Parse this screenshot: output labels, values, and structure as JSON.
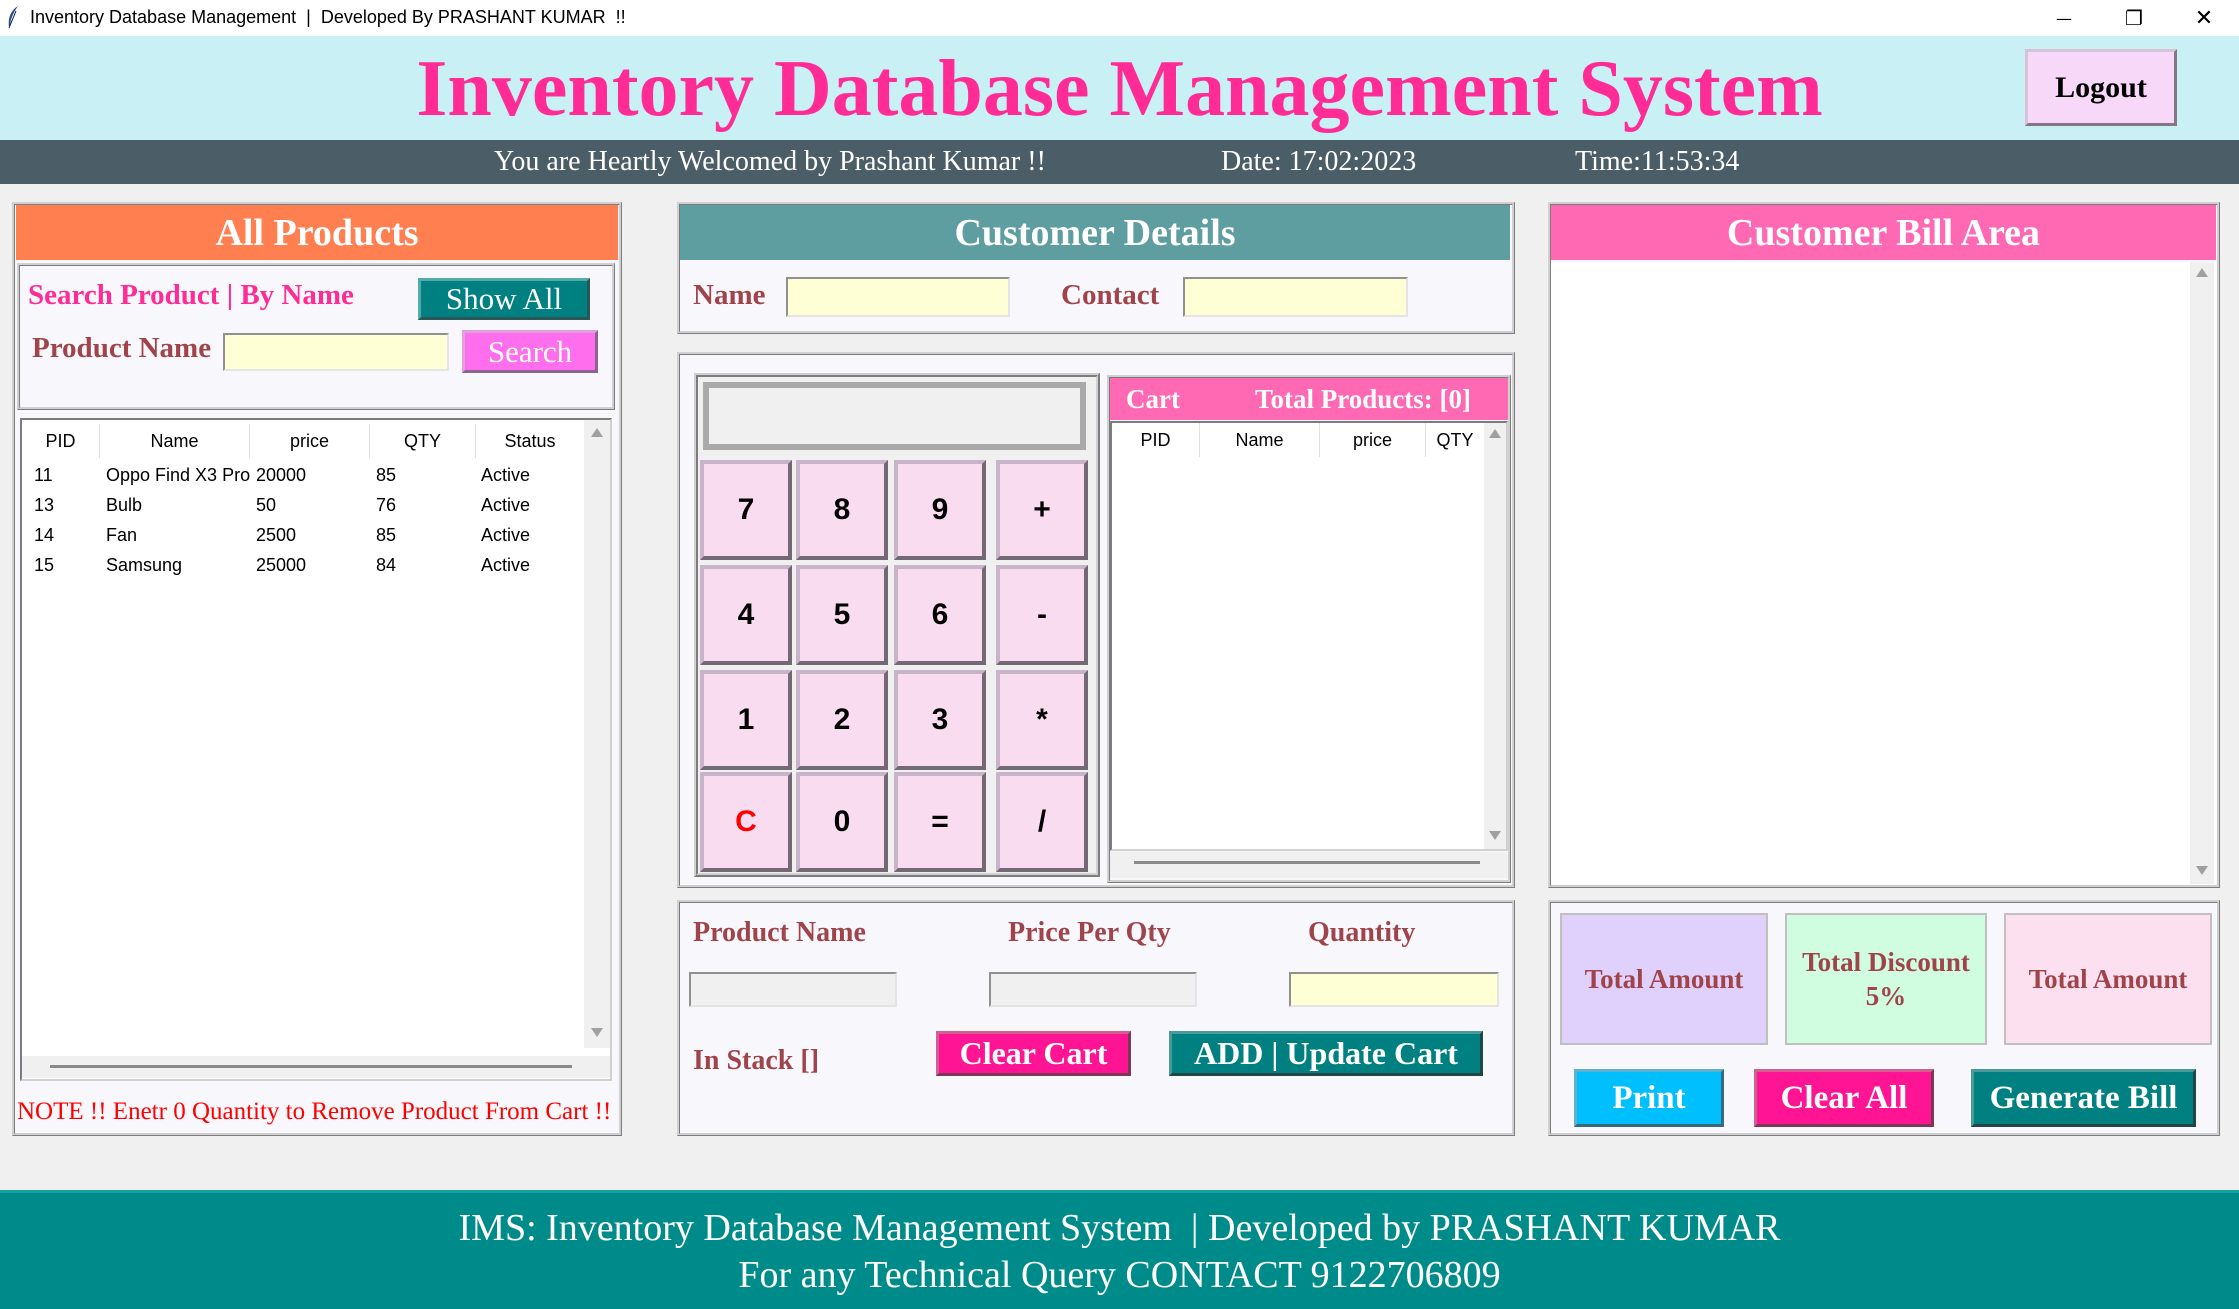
{
  "window": {
    "title": "Inventory Database Management  |  Developed By PRASHANT KUMAR  !!",
    "minimize_glyph": "—",
    "maximize_glyph": "❐",
    "close_glyph": "✕"
  },
  "header": {
    "title": "Inventory Database Management System",
    "logout_label": "Logout",
    "welcome": "You are Heartly Welcomed by Prashant Kumar !!",
    "date": "Date: 17:02:2023",
    "time": "Time:11:53:34"
  },
  "colors": {
    "title_pink": "#ff2c95",
    "all_products_header": "#ff7f50",
    "customer_details_header": "#5f9ea0",
    "bill_area_header": "#ff69b4",
    "teal_button": "#008080",
    "footer_bg": "#008b8b",
    "print_button": "#00bfff"
  },
  "all_products": {
    "header": "All Products",
    "search_label": "Search Product | By Name",
    "show_all_label": "Show All",
    "product_name_label": "Product Name",
    "product_name_value": "",
    "search_button": "Search",
    "columns": [
      "PID",
      "Name",
      "price",
      "QTY",
      "Status"
    ],
    "rows": [
      {
        "pid": "11",
        "name": "Oppo Find X3 Pro",
        "price": "20000",
        "qty": "85",
        "status": "Active"
      },
      {
        "pid": "13",
        "name": "Bulb",
        "price": "50",
        "qty": "76",
        "status": "Active"
      },
      {
        "pid": "14",
        "name": "Fan",
        "price": "2500",
        "qty": "85",
        "status": "Active"
      },
      {
        "pid": "15",
        "name": "Samsung",
        "price": "25000",
        "qty": "84",
        "status": "Active"
      }
    ],
    "note": "NOTE !! Enetr 0 Quantity to Remove Product From Cart !!"
  },
  "customer_details": {
    "header": "Customer Details",
    "name_label": "Name",
    "name_value": "",
    "contact_label": "Contact",
    "contact_value": ""
  },
  "calculator": {
    "display": "",
    "keys": [
      "7",
      "8",
      "9",
      "+",
      "4",
      "5",
      "6",
      "-",
      "1",
      "2",
      "3",
      "*",
      "C",
      "0",
      "=",
      "/"
    ]
  },
  "cart": {
    "title": "Cart",
    "total_products": "Total Products: [0]",
    "columns": [
      "PID",
      "Name",
      "price",
      "QTY"
    ]
  },
  "cart_form": {
    "product_name_label": "Product Name",
    "price_label": "Price Per Qty",
    "quantity_label": "Quantity",
    "product_name_value": "",
    "price_value": "",
    "quantity_value": "",
    "in_stock": "In Stack []",
    "clear_cart_label": "Clear Cart",
    "add_update_label": "ADD | Update Cart"
  },
  "bill": {
    "header": "Customer Bill Area",
    "content": "",
    "total_amount_label": "Total Amount",
    "total_discount_label": "Total Discount",
    "total_discount_pct": "5%",
    "net_amount_label": "Total Amount",
    "print_label": "Print",
    "clear_all_label": "Clear All",
    "generate_bill_label": "Generate Bill"
  },
  "footer": {
    "line1": "IMS: Inventory Database Management System  | Developed by PRASHANT KUMAR",
    "line2": "For any Technical Query CONTACT 9122706809"
  }
}
